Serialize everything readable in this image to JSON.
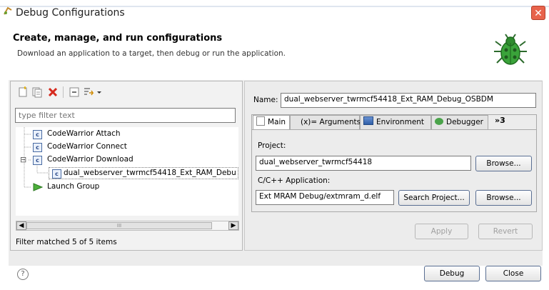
{
  "window": {
    "title": "Debug Configurations",
    "close_symbol": "✕"
  },
  "banner": {
    "title": "Create, manage, and run configurations",
    "subtitle": "Download an application to a target, then debug or run the application."
  },
  "left": {
    "filter_placeholder": "type filter text",
    "tree": [
      {
        "label": "CodeWarrior Attach",
        "badge": "c"
      },
      {
        "label": "CodeWarrior Connect",
        "badge": "c"
      },
      {
        "label": "CodeWarrior Download",
        "badge": "c",
        "expanded": true,
        "toggle": "⊟"
      },
      {
        "label": "dual_webserver_twrmcf54418_Ext_RAM_Debu",
        "badge": "c",
        "selected": true
      },
      {
        "label": "Launch Group",
        "icon": "run-icon"
      }
    ],
    "scroll_thumb": "III",
    "status": "Filter matched 5 of 5 items"
  },
  "config": {
    "name_label": "Name:",
    "name_value": "dual_webserver_twrmcf54418_Ext_RAM_Debug_OSBDM",
    "tabs": [
      {
        "label": "Main",
        "icon": "main-tab-icon"
      },
      {
        "label": "(x)= Arguments",
        "icon": "arguments-tab-icon"
      },
      {
        "label": "Environment",
        "icon": "environment-tab-icon"
      },
      {
        "label": "Debugger",
        "icon": "debugger-tab-icon"
      }
    ],
    "overflow_tabs": "»3",
    "project_label": "Project:",
    "project_value": "dual_webserver_twrmcf54418",
    "app_label": "C/C++ Application:",
    "app_value": "Ext MRAM Debug/extmram_d.elf",
    "browse_label": "Browse...",
    "search_project_label": "Search Project...",
    "apply_label": "Apply",
    "revert_label": "Revert"
  },
  "footer": {
    "help_symbol": "?",
    "debug_label": "Debug",
    "close_label": "Close"
  },
  "colors": {
    "accent": "#5a6f93",
    "close_red": "#e8634b",
    "bug_green": "#3aa33a"
  }
}
